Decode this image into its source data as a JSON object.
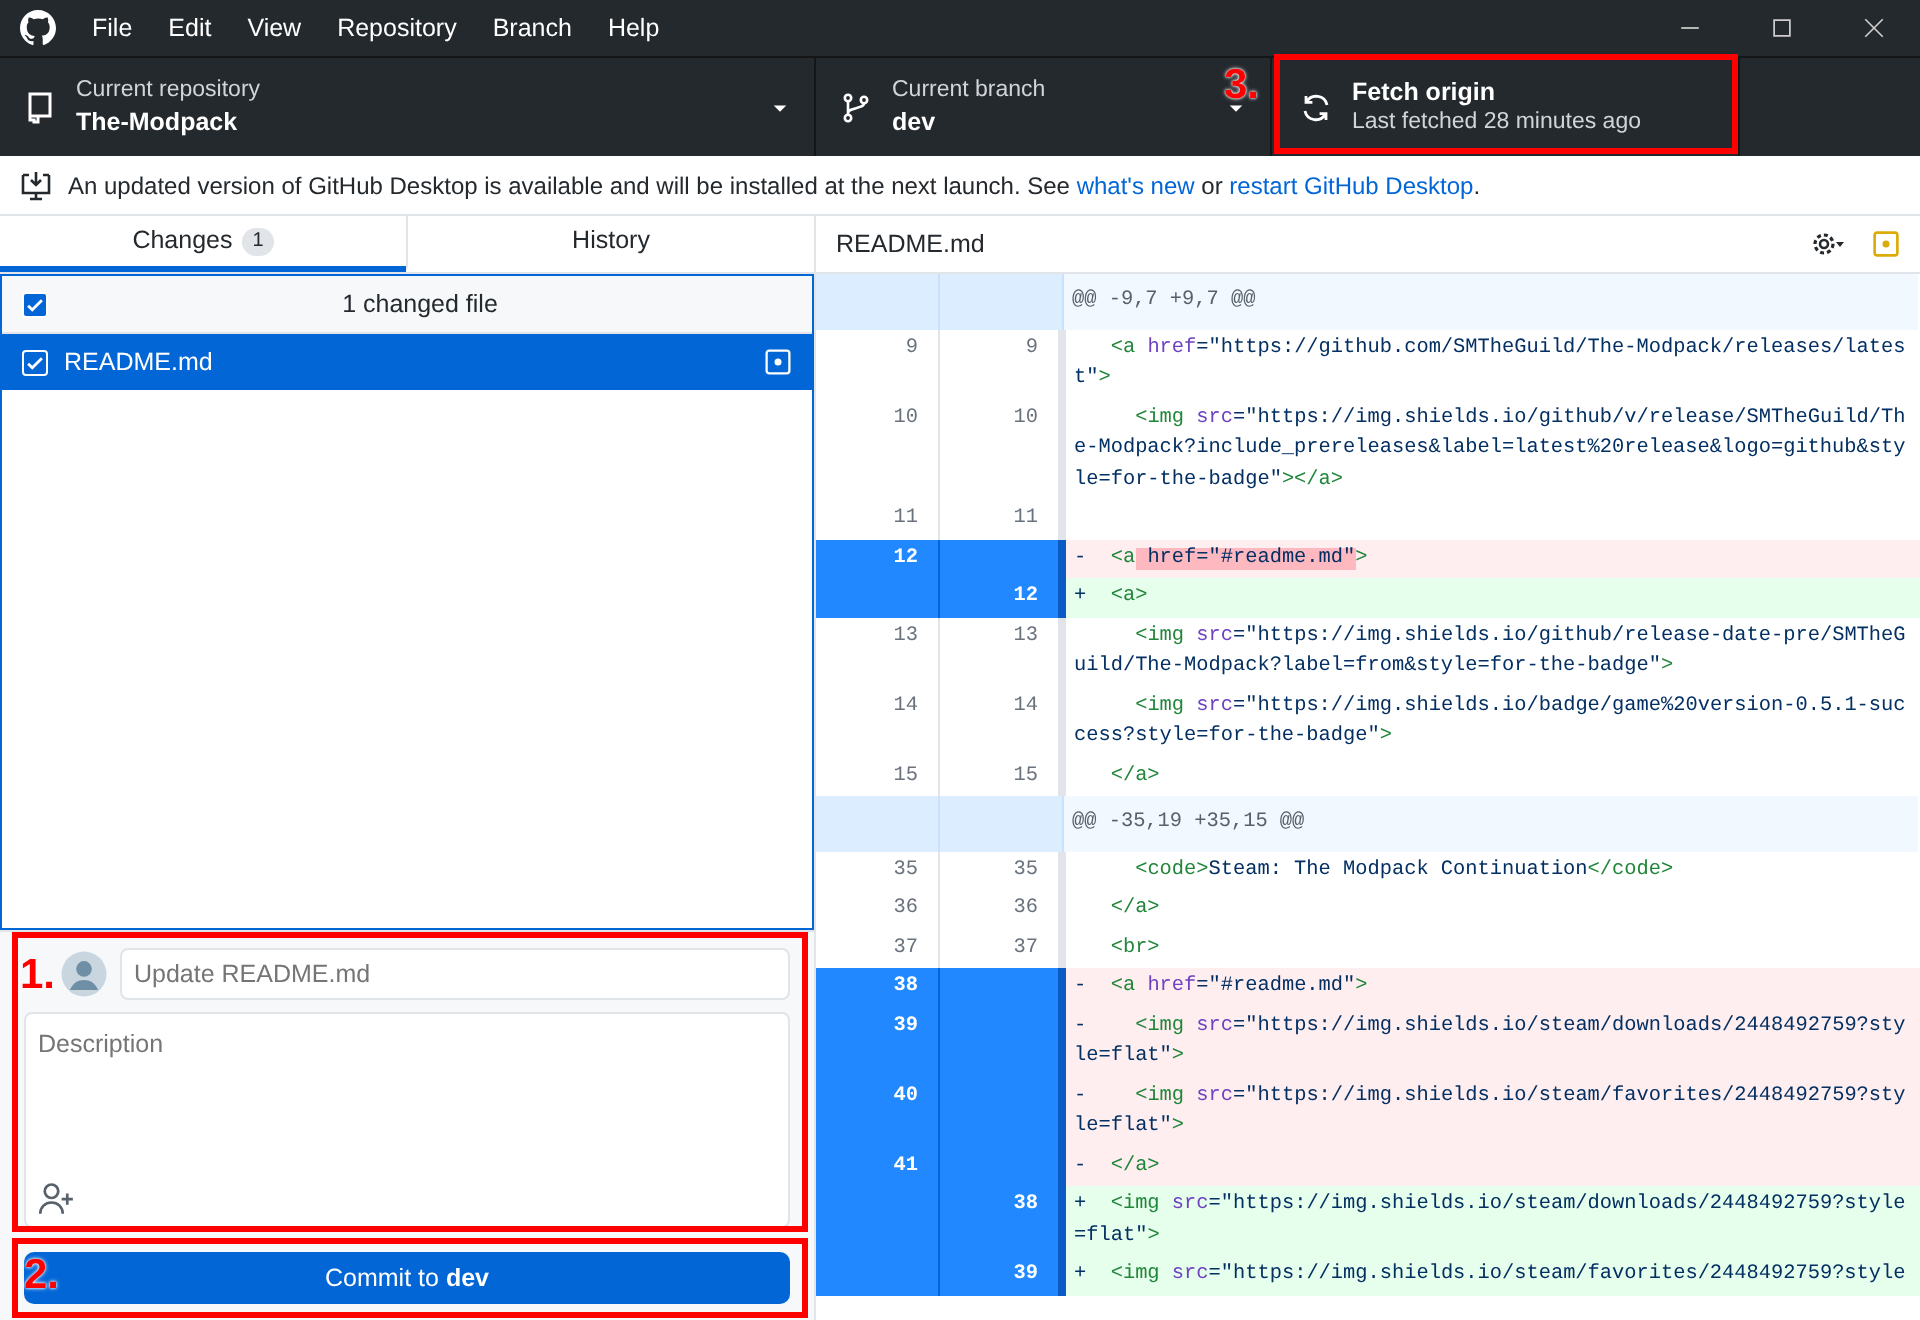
{
  "title_bar": {
    "menu": [
      "File",
      "Edit",
      "View",
      "Repository",
      "Branch",
      "Help"
    ]
  },
  "toolbar": {
    "repository": {
      "label": "Current repository",
      "value": "The-Modpack"
    },
    "branch": {
      "label": "Current branch",
      "value": "dev"
    },
    "fetch": {
      "label": "Fetch origin",
      "detail": "Last fetched 28 minutes ago"
    }
  },
  "banner": {
    "parts": [
      {
        "kind": "text",
        "text": "An updated version of GitHub Desktop is available and will be installed at the next launch. See "
      },
      {
        "kind": "link",
        "text": "what's new"
      },
      {
        "kind": "text",
        "text": " or "
      },
      {
        "kind": "link",
        "text": "restart GitHub Desktop"
      },
      {
        "kind": "text",
        "text": "."
      }
    ]
  },
  "tabs": [
    {
      "label": "Changes",
      "count": "1",
      "selected": true
    },
    {
      "label": "History",
      "selected": false
    }
  ],
  "changes": {
    "header": "1 changed file",
    "all_checked": true,
    "files": [
      {
        "name": "README.md",
        "checked": true,
        "selected": true
      }
    ]
  },
  "commit": {
    "summary_placeholder": "Update README.md",
    "description_placeholder": "Description",
    "button": "Commit to **dev**"
  },
  "diff": {
    "file": "README.md",
    "lines": [
      {
        "kind": "hunk",
        "segments": [
          {
            "kind": "plain",
            "text": "@@ -9,7 +9,7 @@"
          }
        ]
      },
      {
        "kind": "context",
        "old": "9",
        "new": "9",
        "segments": [
          {
            "kind": "tag",
            "text": "   <a"
          },
          {
            "kind": "attr",
            "text": " href"
          },
          {
            "kind": "plain",
            "text": "=\"https://github.com/SMTheGuild/The-Modpack/releases/latest\""
          },
          {
            "kind": "tag",
            "text": ">"
          }
        ]
      },
      {
        "kind": "context",
        "old": "10",
        "new": "10",
        "segments": [
          {
            "kind": "tag",
            "text": "     <img"
          },
          {
            "kind": "attr",
            "text": " src"
          },
          {
            "kind": "plain",
            "text": "=\"https://img.shields.io/github/v/release/SMTheGuild/The-Modpack?include_prereleases&label=latest%20release&logo=github&style=for-the-badge\""
          },
          {
            "kind": "tag",
            "text": "></a>"
          }
        ]
      },
      {
        "kind": "context",
        "old": "11",
        "new": "11"
      },
      {
        "kind": "del",
        "old": "12",
        "selected": true,
        "segments": [
          {
            "kind": "plain",
            "text": "-  "
          },
          {
            "kind": "tag",
            "text": "<a"
          },
          {
            "kind": "mark",
            "text": " href=\"#readme.md\""
          },
          {
            "kind": "tag",
            "text": ">"
          }
        ]
      },
      {
        "kind": "add",
        "new": "12",
        "selected": true,
        "segments": [
          {
            "kind": "plain",
            "text": "+  "
          },
          {
            "kind": "tag",
            "text": "<a>"
          }
        ]
      },
      {
        "kind": "context",
        "old": "13",
        "new": "13",
        "segments": [
          {
            "kind": "tag",
            "text": "     <img"
          },
          {
            "kind": "attr",
            "text": " src"
          },
          {
            "kind": "plain",
            "text": "=\"https://img.shields.io/github/release-date-pre/SMTheGuild/The-Modpack?label=from&style=for-the-badge\""
          },
          {
            "kind": "tag",
            "text": ">"
          }
        ]
      },
      {
        "kind": "context",
        "old": "14",
        "new": "14",
        "segments": [
          {
            "kind": "tag",
            "text": "     <img"
          },
          {
            "kind": "attr",
            "text": " src"
          },
          {
            "kind": "plain",
            "text": "=\"https://img.shields.io/badge/game%20version-0.5.1-success?style=for-the-badge\""
          },
          {
            "kind": "tag",
            "text": ">"
          }
        ]
      },
      {
        "kind": "context",
        "old": "15",
        "new": "15",
        "segments": [
          {
            "kind": "tag",
            "text": "   </a>"
          }
        ]
      },
      {
        "kind": "hunk",
        "segments": [
          {
            "kind": "plain",
            "text": "@@ -35,19 +35,15 @@"
          }
        ]
      },
      {
        "kind": "context",
        "old": "35",
        "new": "35",
        "segments": [
          {
            "kind": "tag",
            "text": "     <code>"
          },
          {
            "kind": "plain",
            "text": "Steam: The Modpack Continuation"
          },
          {
            "kind": "tag",
            "text": "</code>"
          }
        ]
      },
      {
        "kind": "context",
        "old": "36",
        "new": "36",
        "segments": [
          {
            "kind": "tag",
            "text": "   </a>"
          }
        ]
      },
      {
        "kind": "context",
        "old": "37",
        "new": "37",
        "segments": [
          {
            "kind": "tag",
            "text": "   <br>"
          }
        ]
      },
      {
        "kind": "del",
        "old": "38",
        "selected": true,
        "segments": [
          {
            "kind": "plain",
            "text": "-  "
          },
          {
            "kind": "tag",
            "text": "<a"
          },
          {
            "kind": "attr",
            "text": " href"
          },
          {
            "kind": "plain",
            "text": "=\"#readme.md\""
          },
          {
            "kind": "tag",
            "text": ">"
          }
        ]
      },
      {
        "kind": "del",
        "old": "39",
        "selected": true,
        "segments": [
          {
            "kind": "plain",
            "text": "-    "
          },
          {
            "kind": "tag",
            "text": "<img"
          },
          {
            "kind": "attr",
            "text": " src"
          },
          {
            "kind": "plain",
            "text": "=\"https://img.shields.io/steam/downloads/2448492759?style=flat\""
          },
          {
            "kind": "tag",
            "text": ">"
          }
        ]
      },
      {
        "kind": "del",
        "old": "40",
        "selected": true,
        "segments": [
          {
            "kind": "plain",
            "text": "-    "
          },
          {
            "kind": "tag",
            "text": "<img"
          },
          {
            "kind": "attr",
            "text": " src"
          },
          {
            "kind": "plain",
            "text": "=\"https://img.shields.io/steam/favorites/2448492759?style=flat\""
          },
          {
            "kind": "tag",
            "text": ">"
          }
        ]
      },
      {
        "kind": "del",
        "old": "41",
        "selected": true,
        "segments": [
          {
            "kind": "plain",
            "text": "-  "
          },
          {
            "kind": "tag",
            "text": "</a>"
          }
        ]
      },
      {
        "kind": "add",
        "new": "38",
        "selected": true,
        "segments": [
          {
            "kind": "plain",
            "text": "+  "
          },
          {
            "kind": "tag",
            "text": "<img"
          },
          {
            "kind": "attr",
            "text": " src"
          },
          {
            "kind": "plain",
            "text": "=\"https://img.shields.io/steam/downloads/2448492759?style=flat\""
          },
          {
            "kind": "tag",
            "text": ">"
          }
        ]
      },
      {
        "kind": "add",
        "new": "39",
        "selected": true,
        "segments": [
          {
            "kind": "plain",
            "text": "+  "
          },
          {
            "kind": "tag",
            "text": "<img"
          },
          {
            "kind": "attr",
            "text": " src"
          },
          {
            "kind": "plain",
            "text": "=\"https://img.shields.io/steam/favorites/2448492759?style"
          }
        ]
      }
    ]
  },
  "annotations": [
    {
      "label": "1."
    },
    {
      "label": "2."
    },
    {
      "label": "3."
    }
  ]
}
